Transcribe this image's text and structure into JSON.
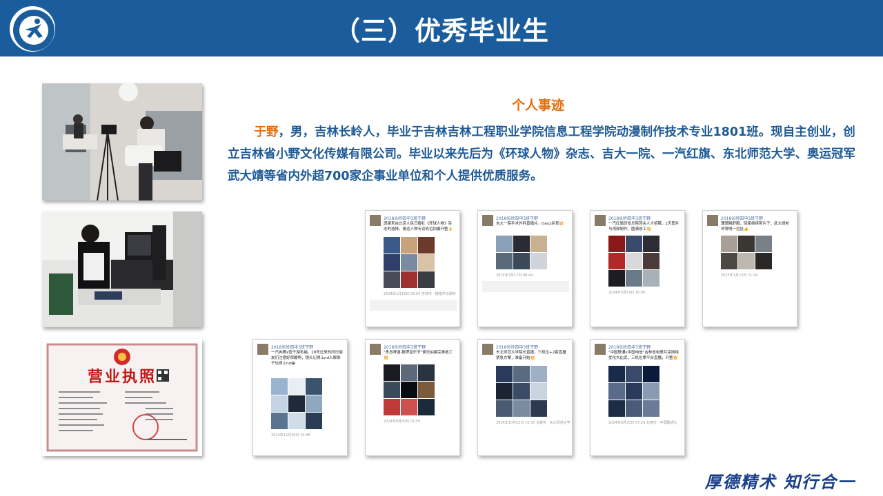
{
  "header": {
    "title": "（三）优秀毕业生",
    "background": "#1a5c9c"
  },
  "section": {
    "title": "个人事迹",
    "name": "于野",
    "body": "，男，吉林长岭人，毕业于吉林吉林工程职业学院信息工程学院动漫制作技术专业1801班。现自主创业，创立吉林省小野文化传媒有限公司。毕业以来先后为《环球人物》杂志、吉大一院、一汽红旗、东北师范大学、奥运冠军武大靖等省内外超700家企事业单位和个人提供优质服务。"
  },
  "photos": [
    {
      "name": "studio-interview-photo"
    },
    {
      "name": "live-broadcast-console-photo"
    },
    {
      "name": "business-license-photo",
      "label": "营业执照"
    }
  ],
  "moments": [
    {
      "user": "2018长岭四中3班于野",
      "caption": "感谢来自北京人民日报社《环球人物》杂志的选择，奥运人物专访机位拍摄开整👌",
      "footer": "2024年1月18日 09:04 吉林市 · 帽帽并马球积"
    },
    {
      "user": "2018长岭四中3班于野",
      "caption": "吉大一院手术外科直播片。Day2杀青💥",
      "footer": "2025年2月17日 08:44"
    },
    {
      "user": "2018长岭四中3班于野",
      "caption": "一汽红旗研发总院顶尖人才招聘，2天图片与视频制作，圆满收工💥",
      "footer": "2024年5月29日 16:00"
    },
    {
      "user": "2018长岭四中3班于野",
      "caption": "珊珊贼舒服，回家继续剪片子，武大靖老师嘿嘿一拉扯👍",
      "footer": "2025年1月13日 21:29"
    },
    {
      "user": "2018长岭四中3班于野",
      "caption": "一汽奔腾x查干湖冬捕，28号过来的同行朋友们注意好保暖啊，镜头记得上nd人眼珠子也得上nd😂",
      "footer": "2024年12月28日 10:48"
    },
    {
      "user": "2018长岭四中3班于野",
      "caption": "\"青岛啤酒·猪啰音乐节\"俩天拍摄完美收工💥",
      "footer": "2024年8月30日 21:59"
    },
    {
      "user": "2018长岭四中3班于野",
      "caption": "东北师范大学院长直播，三机位+2套直播紧急方案，准备开始💥",
      "footer": "2024年10月22日 16:35 长春市 · 东北师范大学"
    },
    {
      "user": "2018长岭四中3班于野",
      "caption": "\"中国联通x中国电信\"吉林省电联共享网络优化大比武，三机位拿平台直播，开整💥",
      "footer": "2024年8月30日 07:29 长春市 · 中国联通大"
    }
  ],
  "footer": {
    "motto": "厚德精术  知行合一"
  },
  "colors": {
    "primary_blue": "#1a5c9c",
    "accent_orange": "#e46c0a",
    "text_blue": "#1e5a96",
    "motto_blue": "#1a3f8a"
  }
}
